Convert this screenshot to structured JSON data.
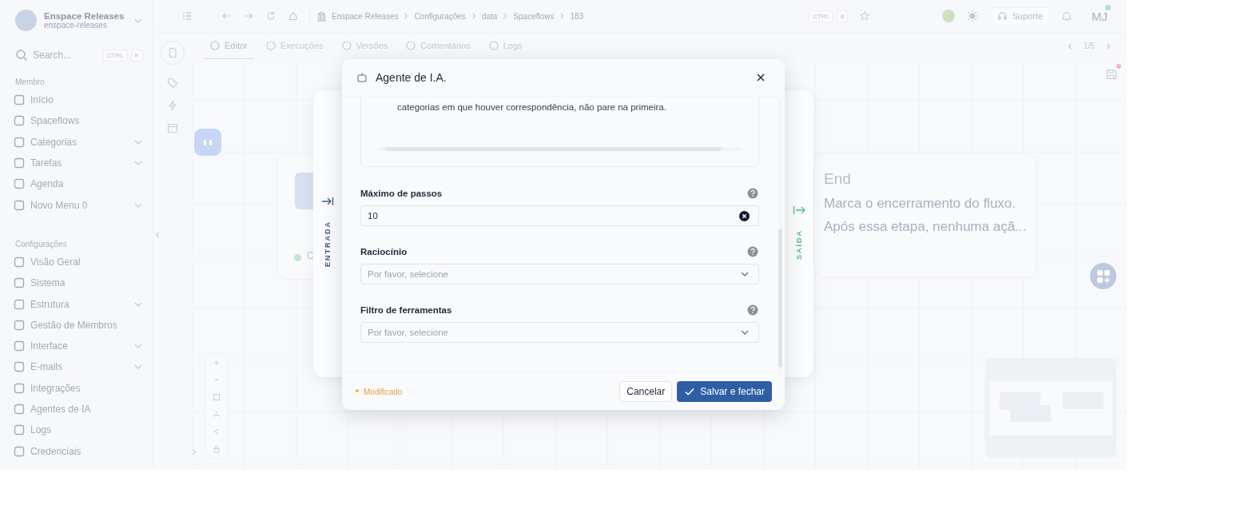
{
  "sidebar": {
    "workspace": {
      "name": "Enspace Releases",
      "slug": "enspace-releases"
    },
    "search": {
      "placeholder": "Search...",
      "shortcut": [
        "CTRL",
        "K"
      ]
    },
    "sections": [
      {
        "title": "Membro",
        "items": [
          {
            "label": "Início",
            "expandable": false
          },
          {
            "label": "Spaceflows",
            "expandable": false
          },
          {
            "label": "Categorias",
            "expandable": true
          },
          {
            "label": "Tarefas",
            "expandable": true
          },
          {
            "label": "Agenda",
            "expandable": false
          },
          {
            "label": "Novo Menu 0",
            "expandable": true
          }
        ]
      },
      {
        "title": "Configurações",
        "items": [
          {
            "label": "Visão Geral",
            "expandable": false
          },
          {
            "label": "Sistema",
            "expandable": false
          },
          {
            "label": "Estrutura",
            "expandable": true
          },
          {
            "label": "Gestão de Membros",
            "expandable": false
          },
          {
            "label": "Interface",
            "expandable": true
          },
          {
            "label": "E-mails",
            "expandable": true
          },
          {
            "label": "Integrações",
            "expandable": false
          },
          {
            "label": "Agentes de IA",
            "expandable": false
          },
          {
            "label": "Logs",
            "expandable": false
          },
          {
            "label": "Credenciais",
            "expandable": false
          }
        ]
      }
    ]
  },
  "topbar": {
    "breadcrumbs": [
      "Enspace Releases",
      "Configurações",
      "data",
      "Spaceflows",
      "183"
    ],
    "shortcut": [
      "CTRL",
      "8"
    ],
    "support": "Suporte",
    "avatar": "MJ"
  },
  "tabs": [
    {
      "label": "Editor",
      "selected": true
    },
    {
      "label": "Execuções",
      "selected": false
    },
    {
      "label": "Versões",
      "selected": false
    },
    {
      "label": "Comentários",
      "selected": false
    },
    {
      "label": "Logs",
      "selected": false
    }
  ],
  "pager": "1/5",
  "canvas": {
    "start_node": {
      "label": "C"
    },
    "end_node": {
      "title": "End",
      "description": [
        "Marca o encerramento do fluxo.",
        "Após essa etapa, nenhuma açã..."
      ]
    },
    "panel": {
      "input_label": "ENTRADA",
      "output_label": "SAÍDA"
    }
  },
  "dialog": {
    "title": "Agente de I.A.",
    "prompt_text": "categorias em que houver correspondência, não pare na primeira.",
    "fields": [
      {
        "kind": "number",
        "label": "Máximo de passos",
        "value": "10"
      },
      {
        "kind": "select",
        "label": "Raciocínio",
        "placeholder": "Por favor, selecione"
      },
      {
        "kind": "select",
        "label": "Filtro de ferramentas",
        "placeholder": "Por favor, selecione"
      }
    ],
    "status": "Modificado",
    "cancel": "Cancelar",
    "save": "Salvar e fechar"
  }
}
